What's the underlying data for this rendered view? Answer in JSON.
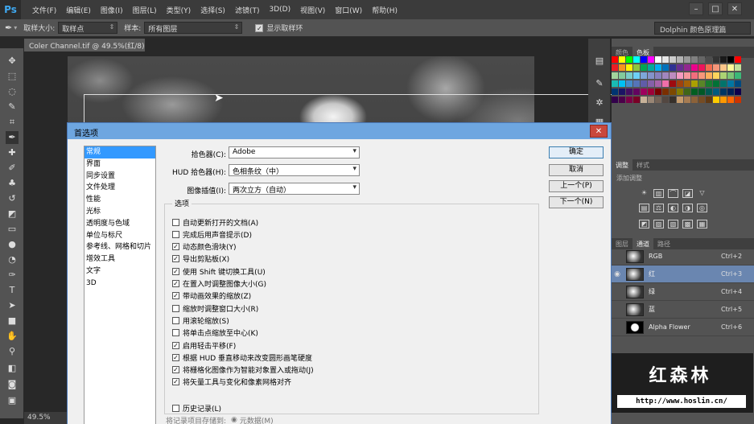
{
  "app": {
    "logo": "Ps",
    "menu": [
      "文件(F)",
      "编辑(E)",
      "图像(I)",
      "图层(L)",
      "类型(Y)",
      "选择(S)",
      "滤镜(T)",
      "3D(D)",
      "视图(V)",
      "窗口(W)",
      "帮助(H)"
    ],
    "window_buttons": [
      "–",
      "□",
      "✕"
    ]
  },
  "options_bar": {
    "sample_size_label": "取样大小:",
    "sample_size_value": "取样点",
    "sample_label": "样本:",
    "sample_value": "所有图层",
    "show_ring_label": "显示取样环",
    "show_ring_checked": true,
    "workspace": "Dolphin 颜色原理篇"
  },
  "document": {
    "tab_title": "Coler Channel.tif @ 49.5%(红/8) *",
    "zoom": "49.5%"
  },
  "panels": {
    "top_tabs": [
      "颜色",
      "色板"
    ],
    "adjust_tabs": [
      "调整",
      "样式"
    ],
    "adjust_hint": "添加调整",
    "channel_tabs": [
      "图层",
      "通道",
      "路径"
    ],
    "channels": [
      {
        "name": "RGB",
        "key": "Ctrl+2",
        "visible": true,
        "active": false
      },
      {
        "name": "红",
        "key": "Ctrl+3",
        "visible": true,
        "active": true
      },
      {
        "name": "绿",
        "key": "Ctrl+4",
        "visible": false,
        "active": false
      },
      {
        "name": "蓝",
        "key": "Ctrl+5",
        "visible": false,
        "active": false
      },
      {
        "name": "Alpha Flower",
        "key": "Ctrl+6",
        "visible": false,
        "active": false
      }
    ]
  },
  "watermark": {
    "title": "红森林",
    "url": "http://www.hoslin.cn/"
  },
  "dialog": {
    "title": "首选项",
    "categories": [
      "常规",
      "界面",
      "同步设置",
      "文件处理",
      "性能",
      "光标",
      "透明度与色域",
      "单位与标尺",
      "参考线、网格和切片",
      "增效工具",
      "文字",
      "3D"
    ],
    "selected_category": "常规",
    "color_picker_label": "拾色器(C):",
    "color_picker_value": "Adobe",
    "hud_picker_label": "HUD 拾色器(H):",
    "hud_picker_value": "色相条纹（中）",
    "interp_label": "图像插值(I):",
    "interp_value": "两次立方（自动）",
    "options_title": "选项",
    "options": [
      {
        "label": "自动更新打开的文档(A)",
        "checked": false
      },
      {
        "label": "完成后用声音提示(D)",
        "checked": false
      },
      {
        "label": "动态颜色滑块(Y)",
        "checked": true
      },
      {
        "label": "导出剪贴板(X)",
        "checked": true
      },
      {
        "label": "使用 Shift 键切换工具(U)",
        "checked": true
      },
      {
        "label": "在置入时调整图像大小(G)",
        "checked": true
      },
      {
        "label": "带动画效果的缩放(Z)",
        "checked": true
      },
      {
        "label": "缩放时调整窗口大小(R)",
        "checked": false
      },
      {
        "label": "用滚轮缩放(S)",
        "checked": false
      },
      {
        "label": "将单击点缩放至中心(K)",
        "checked": false
      },
      {
        "label": "启用轻击平移(F)",
        "checked": true
      },
      {
        "label": "根据 HUD 垂直移动来改变圆形画笔硬度",
        "checked": true
      },
      {
        "label": "将栅格化图像作为智能对象置入或拖动(J)",
        "checked": true
      },
      {
        "label": "将矢量工具与变化和像素网格对齐",
        "checked": true
      }
    ],
    "history_label": "历史记录(L)",
    "history_checked": false,
    "history_save_label": "将记录项目存储到:",
    "history_save_value": "元数据(M)",
    "buttons": {
      "ok": "确定",
      "cancel": "取消",
      "prev": "上一个(P)",
      "next": "下一个(N)"
    }
  }
}
